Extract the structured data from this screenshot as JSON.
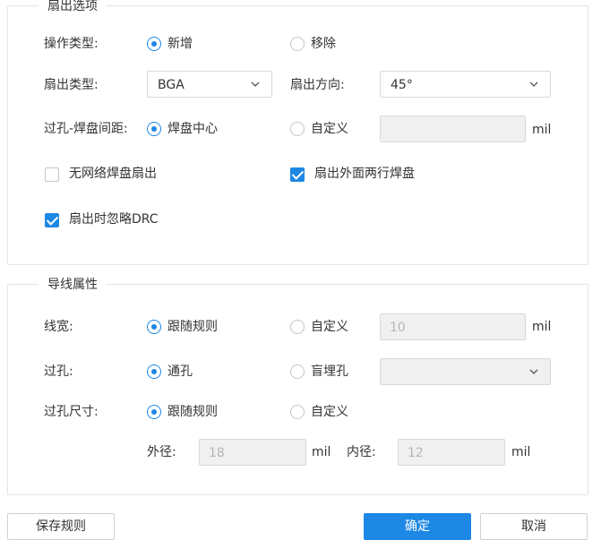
{
  "fanout_section": {
    "legend": "扇出选项",
    "operation_type": {
      "label": "操作类型:",
      "option_add": "新增",
      "option_remove": "移除",
      "selected": "新增"
    },
    "fanout_type": {
      "label": "扇出类型:",
      "value": "BGA"
    },
    "fanout_direction": {
      "label": "扇出方向:",
      "value": "45°"
    },
    "via_pad_spacing": {
      "label": "过孔-焊盘间距:",
      "option_center": "焊盘中心",
      "option_custom": "自定义",
      "selected": "焊盘中心",
      "custom_value": "",
      "unit": "mil"
    },
    "no_net_pad_fanout": {
      "label": "无网络焊盘扇出",
      "checked": false
    },
    "outer_two_rows": {
      "label": "扇出外面两行焊盘",
      "checked": true
    },
    "ignore_drc": {
      "label": "扇出时忽略DRC",
      "checked": true
    }
  },
  "trace_section": {
    "legend": "导线属性",
    "line_width": {
      "label": "线宽:",
      "option_follow": "跟随规则",
      "option_custom": "自定义",
      "selected": "跟随规则",
      "custom_value": "10",
      "unit": "mil"
    },
    "via": {
      "label": "过孔:",
      "option_through": "通孔",
      "option_blind": "盲埋孔",
      "selected": "通孔",
      "blind_value": ""
    },
    "via_size": {
      "label": "过孔尺寸:",
      "option_follow": "跟随规则",
      "option_custom": "自定义",
      "selected": "跟随规则",
      "outer_label": "外径:",
      "outer_value": "18",
      "outer_unit": "mil",
      "inner_label": "内径:",
      "inner_value": "12",
      "inner_unit": "mil"
    }
  },
  "footer": {
    "left_button_partial": "保存规则",
    "ok_button_partial": "确定",
    "cancel_button_partial": "取消"
  },
  "colors": {
    "accent": "#1e88e5",
    "border": "#e4e4e4",
    "disabled_bg": "#f0f0f0",
    "disabled_text": "#b5b5b5"
  },
  "icons": {
    "dropdown": "chevron-down-icon",
    "check": "check-icon"
  }
}
